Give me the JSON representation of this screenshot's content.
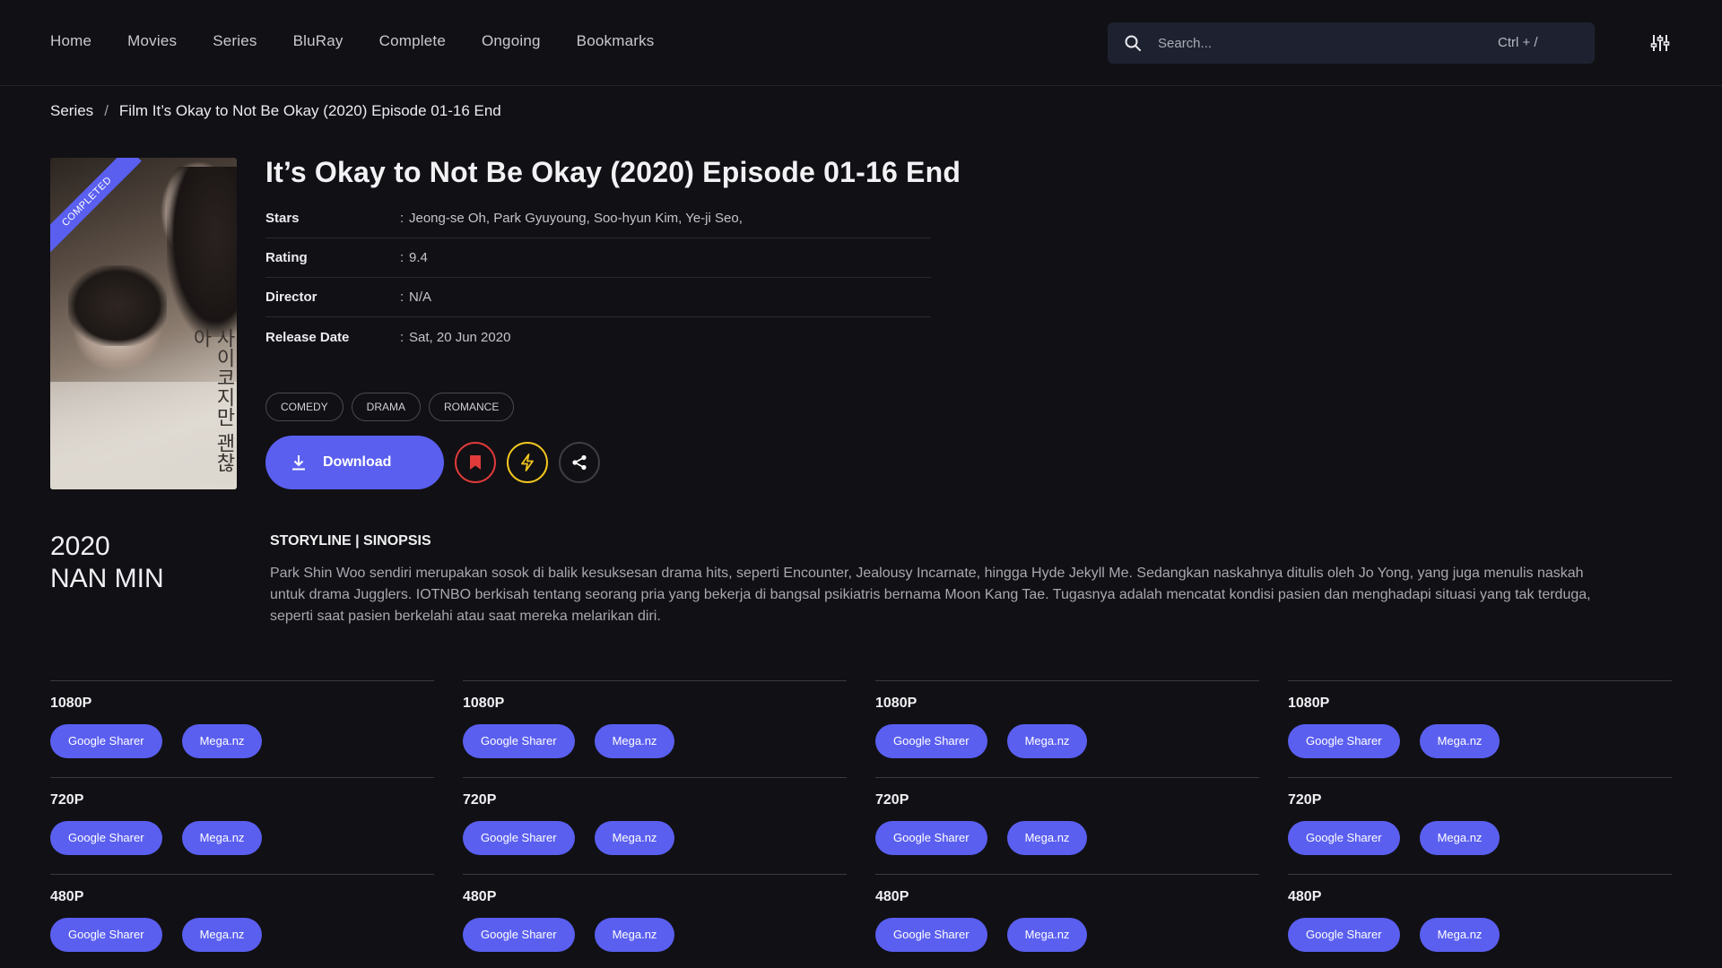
{
  "nav": {
    "items": [
      "Home",
      "Movies",
      "Series",
      "BluRay",
      "Complete",
      "Ongoing",
      "Bookmarks"
    ],
    "search_placeholder": "Search...",
    "search_shortcut": "Ctrl + /"
  },
  "breadcrumb": {
    "section": "Series",
    "separator": "/",
    "current": "Film It’s Okay to Not Be Okay (2020) Episode 01-16 End"
  },
  "poster": {
    "ribbon": "COMPLETED",
    "poster_text": "사이코지만 괜찮아"
  },
  "movie": {
    "title": "It’s Okay to Not Be Okay (2020) Episode 01-16 End",
    "meta": [
      {
        "label": "Stars",
        "value": "Jeong-se Oh, Park Gyuyoung, Soo-hyun Kim, Ye-ji Seo,"
      },
      {
        "label": "Rating",
        "value": "9.4"
      },
      {
        "label": "Director",
        "value": "N/A"
      },
      {
        "label": "Release Date",
        "value": "Sat, 20 Jun 2020"
      }
    ],
    "genres": [
      "COMEDY",
      "DRAMA",
      "ROMANCE"
    ],
    "download_label": "Download",
    "year": "2020",
    "country": "NAN MIN"
  },
  "storyline": {
    "heading": "STORYLINE | SINOPSIS",
    "text": "Park Shin Woo sendiri merupakan sosok di balik kesuksesan drama hits, seperti Encounter, Jealousy Incarnate, hingga Hyde Jekyll Me. Sedangkan naskahnya ditulis oleh Jo Yong, yang juga menulis naskah untuk drama Jugglers. IOTNBO berkisah tentang seorang pria yang bekerja di bangsal psikiatris bernama Moon Kang Tae. Tugasnya adalah mencatat kondisi pasien dan menghadapi situasi yang tak terduga, seperti saat pasien berkelahi atau saat mereka melarikan diri."
  },
  "downloads": {
    "resolutions": [
      "1080P",
      "720P",
      "480P"
    ],
    "links": [
      "Google Sharer",
      "Mega.nz"
    ],
    "columns": 4
  },
  "colors": {
    "accent": "#5a5ff0",
    "background": "#111014",
    "bookmark": "#e03a3a",
    "bolt": "#f2c61f"
  },
  "icons": [
    "search-icon",
    "filter-sliders-icon",
    "download-icon",
    "bookmark-icon",
    "bolt-icon",
    "share-icon"
  ]
}
